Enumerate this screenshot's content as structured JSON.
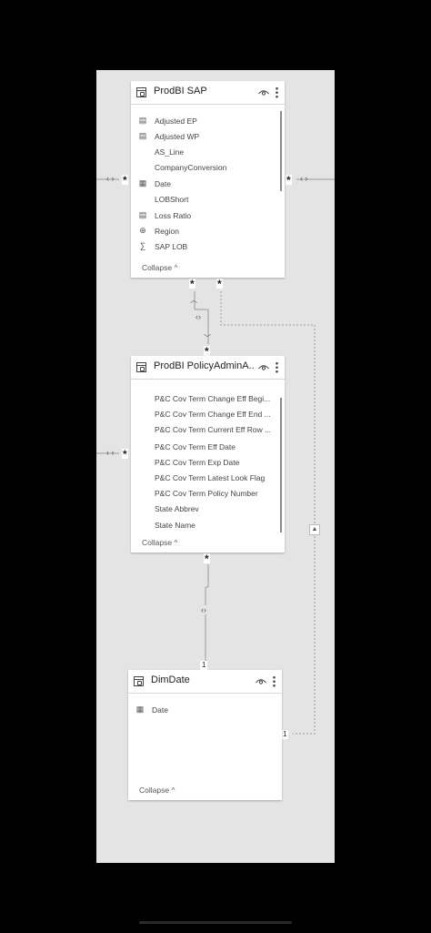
{
  "tables": [
    {
      "title": "ProdBI SAP",
      "fields": [
        {
          "label": "Adjusted EP",
          "icon": "table-measure-icon"
        },
        {
          "label": "Adjusted WP",
          "icon": "table-measure-icon"
        },
        {
          "label": "AS_Line",
          "icon": ""
        },
        {
          "label": "CompanyConversion",
          "icon": ""
        },
        {
          "label": "Date",
          "icon": "calendar-hierarchy-icon"
        },
        {
          "label": "LOBShort",
          "icon": ""
        },
        {
          "label": "Loss Ratio",
          "icon": "table-measure-icon"
        },
        {
          "label": "Region",
          "icon": "globe-icon"
        },
        {
          "label": "SAP LOB",
          "icon": "sigma-icon"
        }
      ],
      "collapse_label": "Collapse"
    },
    {
      "title": "ProdBI PolicyAdminA...",
      "fields": [
        {
          "label": "P&C Cov Term Change Eff Begi...",
          "icon": ""
        },
        {
          "label": "P&C Cov Term Change Eff End ...",
          "icon": ""
        },
        {
          "label": "P&C Cov Term Current Eff Row ...",
          "icon": ""
        },
        {
          "label": "P&C Cov Term Eff Date",
          "icon": ""
        },
        {
          "label": "P&C Cov Term Exp Date",
          "icon": ""
        },
        {
          "label": "P&C Cov Term Latest Look Flag",
          "icon": ""
        },
        {
          "label": "P&C Cov Term Policy Number",
          "icon": ""
        },
        {
          "label": "State Abbrev",
          "icon": ""
        },
        {
          "label": "State Name",
          "icon": ""
        }
      ],
      "collapse_label": "Collapse"
    },
    {
      "title": "DimDate",
      "fields": [
        {
          "label": "Date",
          "icon": "calendar-icon"
        }
      ],
      "collapse_label": "Collapse"
    }
  ],
  "relationships": {
    "many_symbol": "*",
    "one_symbol": "1"
  },
  "colors": {
    "canvas": "#e4e4e4",
    "background": "#000000",
    "card": "#ffffff",
    "line": "#9a9a9a"
  }
}
